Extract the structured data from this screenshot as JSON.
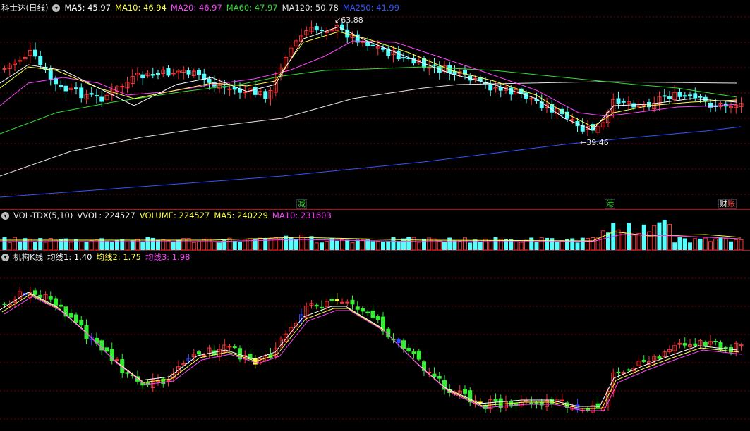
{
  "price_panel": {
    "title": "科士达(日线)",
    "indicators": [
      {
        "label": "MA5: 45.97",
        "color": "#ffffff"
      },
      {
        "label": "MA10: 46.94",
        "color": "#ffff44"
      },
      {
        "label": "MA20: 46.97",
        "color": "#ff44ff"
      },
      {
        "label": "MA60: 47.97",
        "color": "#33dd33"
      },
      {
        "label": "MA120: 50.78",
        "color": "#e6e6e6"
      },
      {
        "label": "MA250: 41.99",
        "color": "#3355ff"
      }
    ],
    "high_label": "63.88",
    "low_label": "39.46",
    "event_marks": [
      {
        "text": "减",
        "color": "#33dd33"
      },
      {
        "text": "港",
        "color": "#33dd33"
      },
      {
        "text": "账",
        "color": "#ff4444"
      }
    ]
  },
  "volume_panel": {
    "indicators": [
      {
        "label": "VOL-TDX(5,10)",
        "color": "#e6e6e6"
      },
      {
        "label": "VVOL: 224527",
        "color": "#e6e6e6"
      },
      {
        "label": "VOLUME: 224527",
        "color": "#ffff44"
      },
      {
        "label": "MA5: 240229",
        "color": "#ffff44"
      },
      {
        "label": "MA10: 231603",
        "color": "#ff44ff"
      }
    ]
  },
  "indicator_panel": {
    "indicators": [
      {
        "label": "机构K线",
        "color": "#e6e6e6"
      },
      {
        "label": "均线1: 1.40",
        "color": "#ffffff"
      },
      {
        "label": "均线2: 1.75",
        "color": "#ffff44"
      },
      {
        "label": "均线3: 1.98",
        "color": "#ff44ff"
      }
    ]
  },
  "colors": {
    "up": "#ff3333",
    "down": "#54ffff",
    "ind_down": "#33ee33",
    "ind_blue": "#3344ff",
    "ind_yellow": "#ffff33",
    "grid": "#7a0000"
  }
}
